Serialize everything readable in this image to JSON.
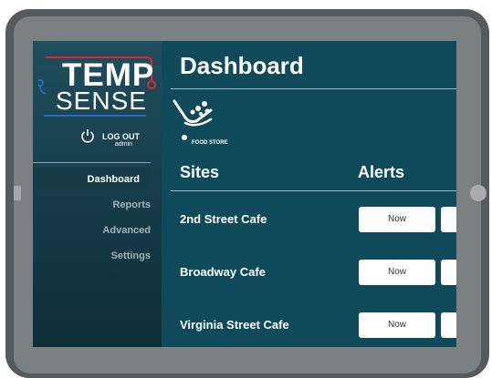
{
  "app": {
    "logo_top": "TEMP",
    "logo_bottom": "SENSE"
  },
  "account": {
    "logout_label": "LOG OUT",
    "user": "admin"
  },
  "sidebar": {
    "items": [
      {
        "label": "Dashboard",
        "active": true
      },
      {
        "label": "Reports",
        "active": false
      },
      {
        "label": "Advanced",
        "active": false
      },
      {
        "label": "Settings",
        "active": false
      }
    ]
  },
  "main": {
    "title": "Dashboard",
    "store_logo_text": "FOOD STORE",
    "columns": {
      "sites": "Sites",
      "alerts": "Alerts"
    },
    "sites": [
      {
        "name": "2nd Street Cafe",
        "button": "Now"
      },
      {
        "name": "Broadway Cafe",
        "button": "Now"
      },
      {
        "name": "Virginia Street Cafe",
        "button": "Now"
      }
    ]
  },
  "colors": {
    "screen_bg": "#0f4a5a",
    "accent_red": "#d9283a",
    "accent_blue": "#2a67c9"
  },
  "icons": [
    "power-icon",
    "food-store-cart-icon"
  ]
}
